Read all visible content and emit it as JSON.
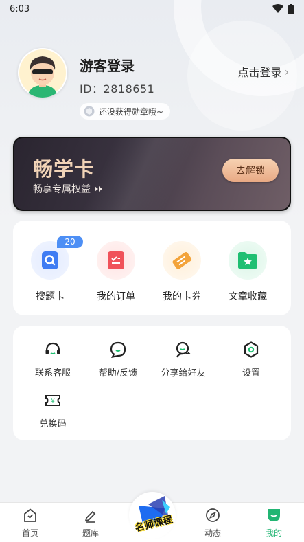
{
  "status_bar": {
    "time": "6:03"
  },
  "profile": {
    "name": "游客登录",
    "id_text": "ID：2818651",
    "login_link": "点击登录",
    "badge_text": "还没获得勋章哦~"
  },
  "vip_card": {
    "title": "畅学卡",
    "subtitle": "畅享专属权益",
    "button": "去解锁"
  },
  "quick_items": [
    {
      "label": "搜题卡",
      "icon": "search-card-icon",
      "badge": "20",
      "color": "#3f7cf3"
    },
    {
      "label": "我的订单",
      "icon": "order-icon",
      "color": "#f0525a"
    },
    {
      "label": "我的卡券",
      "icon": "coupon-icon",
      "color": "#f3a33a"
    },
    {
      "label": "文章收藏",
      "icon": "folder-star-icon",
      "color": "#1fbf72"
    }
  ],
  "tools": [
    {
      "label": "联系客服",
      "icon": "headset-icon"
    },
    {
      "label": "帮助/反馈",
      "icon": "chat-bubble-icon"
    },
    {
      "label": "分享给好友",
      "icon": "share-user-icon"
    },
    {
      "label": "设置",
      "icon": "hexagon-settings-icon"
    },
    {
      "label": "兑换码",
      "icon": "ticket-icon"
    }
  ],
  "tabbar": {
    "tabs": [
      {
        "label": "首页",
        "icon": "home-icon"
      },
      {
        "label": "题库",
        "icon": "edit-icon"
      },
      {
        "label": "动态",
        "icon": "compass-icon"
      },
      {
        "label": "我的",
        "icon": "profile-icon",
        "active": true
      }
    ],
    "center_label": "名师课程"
  },
  "colors": {
    "accent": "#22b573",
    "vip_gold": "#f1d3b7"
  }
}
